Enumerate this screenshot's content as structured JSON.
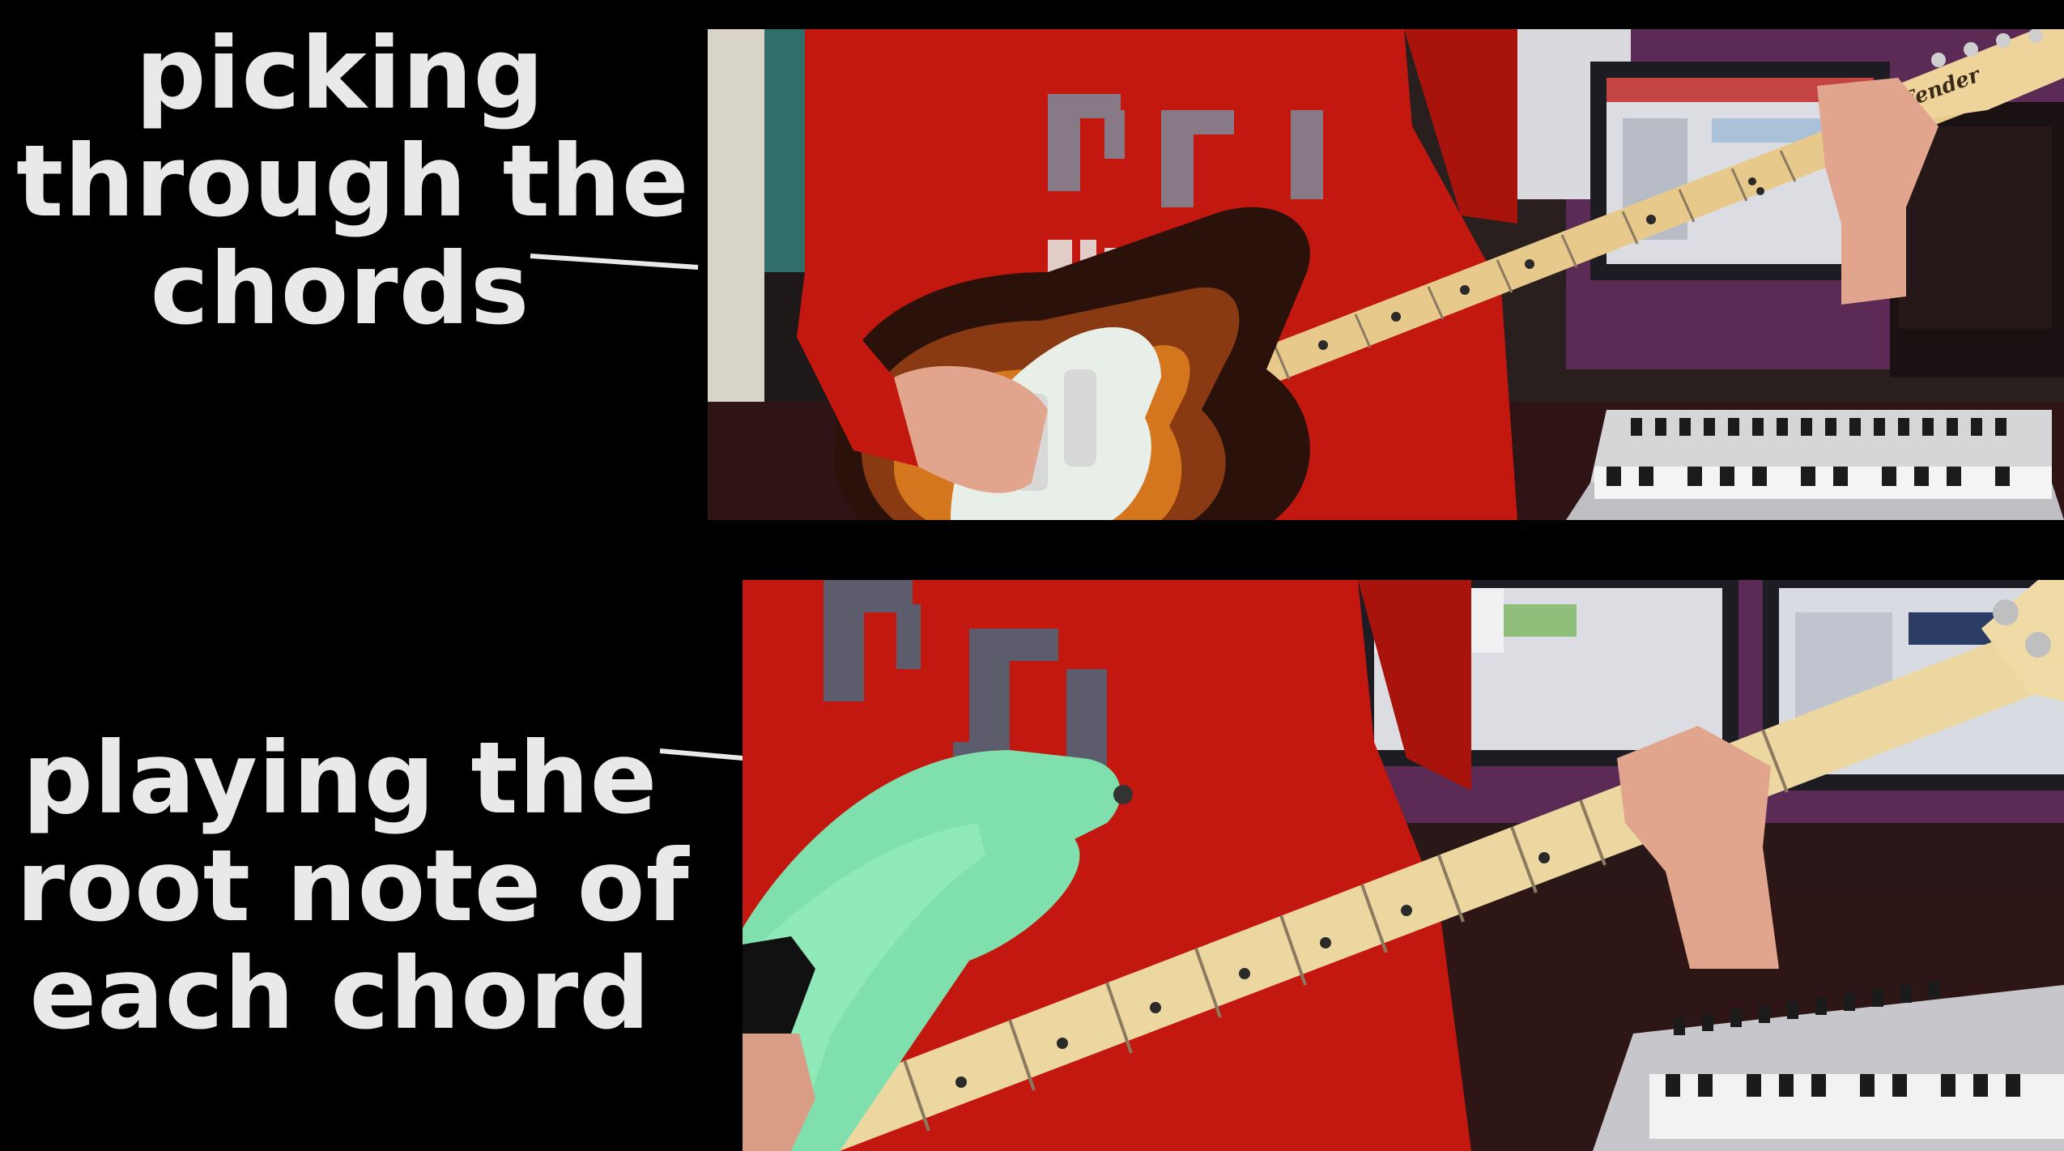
{
  "captions": {
    "top": {
      "lines": [
        "picking",
        "through the",
        "chords"
      ]
    },
    "bottom": {
      "lines": [
        "playing the",
        "root note of",
        "each chord"
      ]
    }
  },
  "photos": {
    "top": {
      "guitar_logo": "Fender"
    }
  },
  "colors": {
    "caption_text": "#e9e9e9",
    "background": "#000000",
    "hoodie_red": "#c2180f",
    "bass_body_green": "#7fe0ad",
    "sunburst_body": "#2a120a",
    "pickguard": "#e8efe9",
    "maple_neck": "#e8c98c"
  }
}
